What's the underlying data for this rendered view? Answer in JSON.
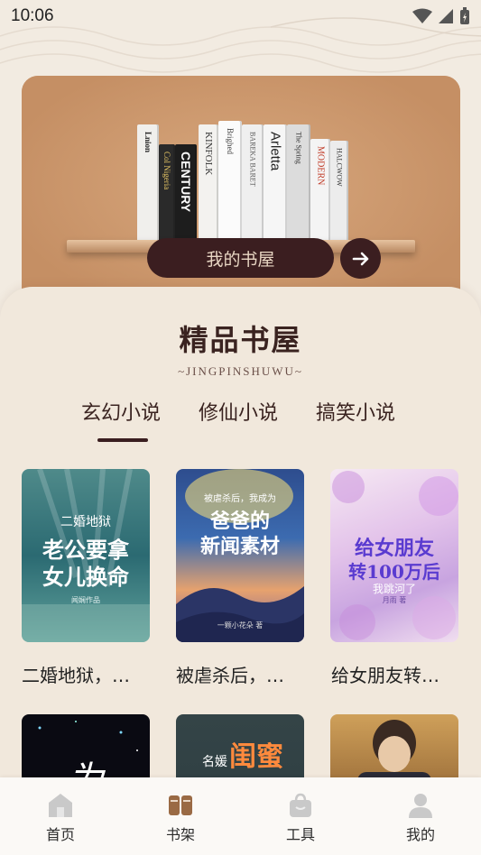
{
  "status": {
    "time": "10:06"
  },
  "banner": {
    "button_label": "我的书屋",
    "spines": [
      "Lnion",
      "Col Nigeria",
      "CENTURY",
      "KINFOLK",
      "Brighed",
      "BAREKA BARET",
      "Arletta",
      "The Spring",
      "MODERN",
      "HALCWOW"
    ]
  },
  "section": {
    "title": "精品书屋",
    "subtitle": "~JINGPINSHUWU~",
    "tabs": [
      "玄幻小说",
      "修仙小说",
      "搞笑小说"
    ],
    "active_tab": 0
  },
  "books": [
    {
      "title": "二婚地狱，…",
      "cover_lines": [
        "二婚地狱",
        "老公要拿",
        "女儿换命"
      ],
      "cover_author": "闻娴作品"
    },
    {
      "title": "被虐杀后，…",
      "cover_lines": [
        "被虐杀后，我成为",
        "爸爸的",
        "新闻素材"
      ],
      "cover_author": "一颗小花朵 著"
    },
    {
      "title": "给女朋友转…",
      "cover_lines": [
        "给女朋友",
        "转100万后",
        "我跳河了"
      ],
      "cover_author": "月雨 著"
    },
    {
      "title": "",
      "cover_lines": [
        "为"
      ]
    },
    {
      "title": "",
      "cover_lines": [
        "名媛",
        "闺蜜"
      ]
    },
    {
      "title": "",
      "cover_lines": []
    }
  ],
  "nav": {
    "items": [
      {
        "label": "首页",
        "icon": "home-icon"
      },
      {
        "label": "书架",
        "icon": "bookshelf-icon"
      },
      {
        "label": "工具",
        "icon": "bag-icon"
      },
      {
        "label": "我的",
        "icon": "user-icon"
      }
    ],
    "active": 1
  },
  "colors": {
    "accent": "#3b1e20",
    "banner": "#c9966b",
    "background": "#f2ebe1"
  }
}
